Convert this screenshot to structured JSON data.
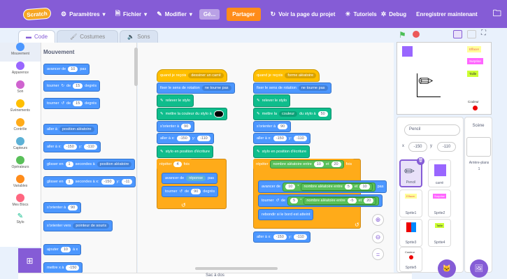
{
  "menubar": {
    "logo": "Scratch",
    "settings": "Paramètres",
    "file": "Fichier",
    "edit": "Modifier",
    "ge": "Gé...",
    "share": "Partager",
    "project_page": "Voir la page du projet",
    "tutorials": "Tutoriels",
    "debug": "Debug",
    "save": "Enregistrer maintenant"
  },
  "tabs": {
    "code": "Code",
    "costumes": "Costumes",
    "sounds": "Sons"
  },
  "categories": [
    {
      "label": "Mouvement",
      "color": "#4c97ff"
    },
    {
      "label": "Apparence",
      "color": "#9966ff"
    },
    {
      "label": "Son",
      "color": "#cf63cf"
    },
    {
      "label": "Événements",
      "color": "#ffbf00"
    },
    {
      "label": "Contrôle",
      "color": "#ffab19"
    },
    {
      "label": "Capteurs",
      "color": "#5cb1d6"
    },
    {
      "label": "Opérateurs",
      "color": "#59c059"
    },
    {
      "label": "Variables",
      "color": "#ff8c1a"
    },
    {
      "label": "Mes Blocs",
      "color": "#ff6680"
    },
    {
      "label": "Stylo",
      "color": "#0fbd8c"
    }
  ],
  "palette": {
    "title": "Mouvement",
    "b1": "avancer de",
    "b1v": "10",
    "b1u": "pas",
    "b2": "tourner",
    "b2d": "de",
    "b2v": "15",
    "b2u": "degrés",
    "b3": "tourner",
    "b3d": "de",
    "b3v": "15",
    "b3u": "degrés",
    "b4": "aller à",
    "b4v": "position aléatoire",
    "b5": "aller à x:",
    "b5x": "-150",
    "b5y": "y:",
    "b5yv": "-110",
    "b6": "glisser en",
    "b6v": "1",
    "b6s": "secondes à",
    "b6t": "position aléatoire",
    "b7": "glisser en",
    "b7v": "1",
    "b7s": "secondes à x:",
    "b7x": "-150",
    "b7y": "y:",
    "b7yv": "-11",
    "b8": "s'orienter à",
    "b8v": "90",
    "b9": "s'orienter vers",
    "b9v": "pointeur de souris",
    "b10": "ajouter",
    "b10v": "10",
    "b10u": "à x",
    "b11": "mettre x à",
    "b11v": "-150"
  },
  "script1": {
    "hat": "quand je reçois",
    "hatv": "dessiner un carré",
    "rot": "fixer le sens de rotation",
    "rotv": "ne tourne pas",
    "penup": "relever le stylo",
    "color": "mettre la couleur du stylo à",
    "orient": "s'orienter à",
    "orientv": "90",
    "goto": "aller à x:",
    "gotox": "-150",
    "gotoy": "y:",
    "gotoyv": "-110",
    "pendown": "stylo en position d'écriture",
    "repeat": "répéter",
    "repeatv": "4",
    "repeatu": "fois",
    "move": "avancer de",
    "movev": "réponse",
    "moveu": "pas",
    "turn": "tourner",
    "turnd": "de",
    "turnv": "90",
    "turnu": "degrés"
  },
  "script2": {
    "hat": "quand je reçois",
    "hatv": "forme aléatoire",
    "rot": "fixer le sens de rotation",
    "rotv": "ne tourne pas",
    "penup": "relever le stylo",
    "color": "mettre la",
    "colorv": "couleur",
    "colort": "du stylo à",
    "colornum": "50",
    "orient": "s'orienter à",
    "orientv": "90",
    "goto": "aller à x:",
    "gotox": "-150",
    "gotoy": "y:",
    "gotoyv": "-110",
    "pendown": "stylo en position d'écriture",
    "repeat": "répéter",
    "rand": "nombre aléatoire entre",
    "r1": "10",
    "et": "et",
    "r2": "20",
    "fois": "fois",
    "move": "avancer de",
    "m1": "10",
    "mul": "*",
    "mrand": "nombre aléatoire entre",
    "m2": "5",
    "met": "et",
    "m3": "10",
    "mu": "pas",
    "turn": "tourner",
    "turnd": "de",
    "t1": "5",
    "tmul": "*",
    "trand": "nombre aléatoire entre",
    "t2": "-5",
    "tet": "et",
    "t3": "20",
    "bounce": "rebondir si le bord est atteint",
    "goto2": "aller à x:",
    "g2x": "-150",
    "g2y": "y:",
    "g2yv": "-110"
  },
  "workspace": {
    "bag": "Sac à dos"
  },
  "stage_labels": {
    "effacer": "Effacer",
    "surprise": "Surprise",
    "taille": "Taille",
    "couleur": "Couleur"
  },
  "sprite_info": {
    "name": "Pencil",
    "x_label": "x",
    "x": "-150",
    "y_label": "y",
    "y": "-110"
  },
  "stage_panel": {
    "title": "Scène",
    "backdrops": "Arrière-plans",
    "count": "1"
  },
  "sprites": [
    {
      "name": "Pencil"
    },
    {
      "name": "carré"
    },
    {
      "name": "Sprite1"
    },
    {
      "name": "Sprite2"
    },
    {
      "name": "Sprite3"
    },
    {
      "name": "Sprite4"
    },
    {
      "name": "Sprite5"
    }
  ],
  "sprite_mini": {
    "effacer": "Effacer",
    "surprise": "Surprise",
    "taille": "Taille",
    "couleur": "Couleur"
  }
}
